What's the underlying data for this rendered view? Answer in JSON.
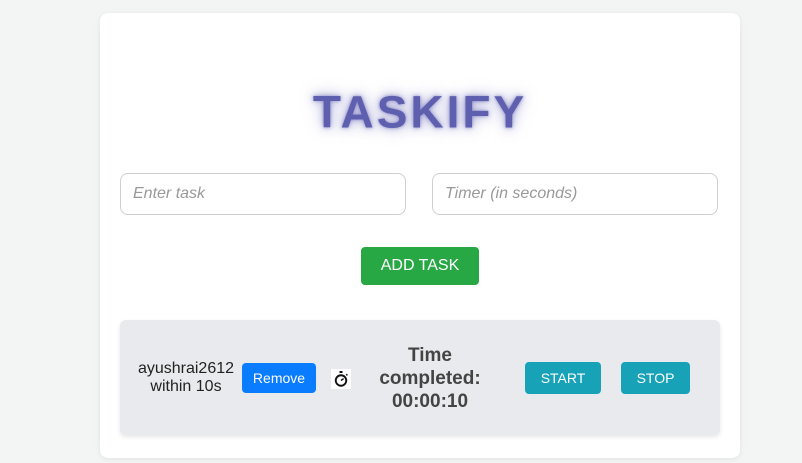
{
  "app": {
    "title": "TASKIFY"
  },
  "form": {
    "task_placeholder": "Enter task",
    "task_value": "",
    "timer_placeholder": "Timer (in seconds)",
    "timer_value": "",
    "add_label": "ADD TASK"
  },
  "tasks": [
    {
      "name": "ayushrai2612",
      "duration": "within 10s",
      "remove_label": "Remove",
      "timer_icon": "stopwatch-icon",
      "status_line1": "Time",
      "status_line2": "completed:",
      "status_line3": "00:00:10",
      "start_label": "START",
      "stop_label": "STOP"
    }
  ],
  "colors": {
    "background": "#f3f5f5",
    "logo": "#5f5fb0",
    "add_button": "#28a745",
    "remove_button": "#0a7cff",
    "control_button": "#17a2b8",
    "task_row": "#e8eaed"
  }
}
